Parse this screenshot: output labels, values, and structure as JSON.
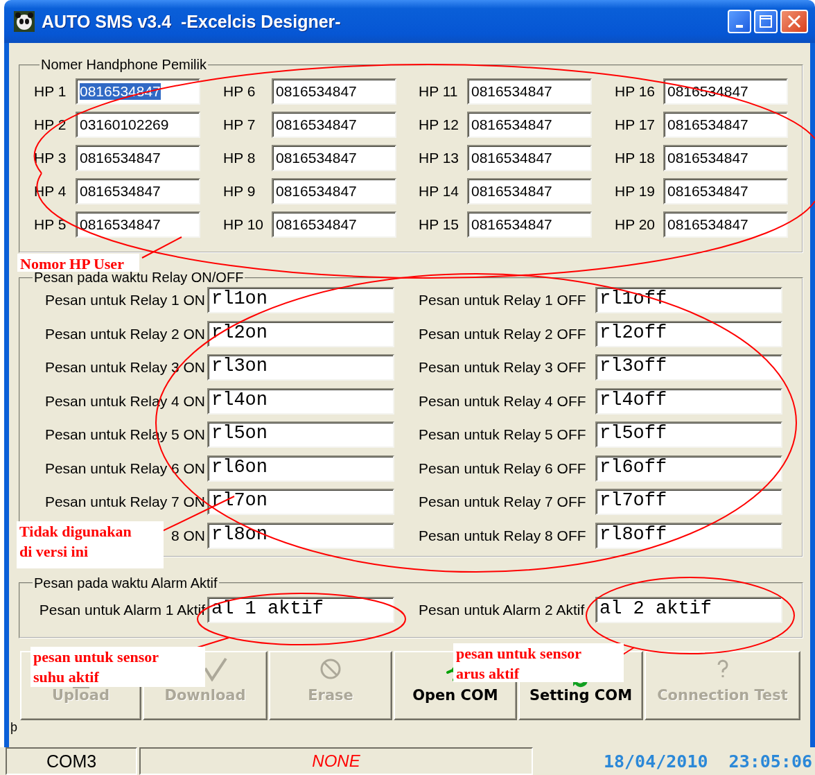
{
  "window": {
    "title": "AUTO SMS v3.4  -Excelcis Designer-"
  },
  "owner_numbers": {
    "legend": "Nomer Handphone Pemilik",
    "fields": [
      {
        "label": "HP 1",
        "value": "0816534847",
        "selected": true
      },
      {
        "label": "HP 2",
        "value": "03160102269",
        "selected": false
      },
      {
        "label": "HP 3",
        "value": "0816534847",
        "selected": false
      },
      {
        "label": "HP 4",
        "value": "0816534847",
        "selected": false
      },
      {
        "label": "HP 5",
        "value": "0816534847",
        "selected": false
      },
      {
        "label": "HP 6",
        "value": "0816534847",
        "selected": false
      },
      {
        "label": "HP 7",
        "value": "0816534847",
        "selected": false
      },
      {
        "label": "HP 8",
        "value": "0816534847",
        "selected": false
      },
      {
        "label": "HP 9",
        "value": "0816534847",
        "selected": false
      },
      {
        "label": "HP 10",
        "value": "0816534847",
        "selected": false
      },
      {
        "label": "HP 11",
        "value": "0816534847",
        "selected": false
      },
      {
        "label": "HP 12",
        "value": "0816534847",
        "selected": false
      },
      {
        "label": "HP 13",
        "value": "0816534847",
        "selected": false
      },
      {
        "label": "HP 14",
        "value": "0816534847",
        "selected": false
      },
      {
        "label": "HP 15",
        "value": "0816534847",
        "selected": false
      },
      {
        "label": "HP 16",
        "value": "0816534847",
        "selected": false
      },
      {
        "label": "HP 17",
        "value": "0816534847",
        "selected": false
      },
      {
        "label": "HP 18",
        "value": "0816534847",
        "selected": false
      },
      {
        "label": "HP 19",
        "value": "0816534847",
        "selected": false
      },
      {
        "label": "HP 20",
        "value": "0816534847",
        "selected": false
      }
    ]
  },
  "relay_messages": {
    "legend": "Pesan pada waktu Relay ON/OFF",
    "rows": [
      {
        "on_label": "Pesan untuk Relay 1 ON",
        "on_value": "rl1on",
        "off_label": "Pesan untuk Relay 1 OFF",
        "off_value": "rl1off"
      },
      {
        "on_label": "Pesan untuk Relay 2 ON",
        "on_value": "rl2on",
        "off_label": "Pesan untuk Relay 2 OFF",
        "off_value": "rl2off"
      },
      {
        "on_label": "Pesan untuk Relay 3 ON",
        "on_value": "rl3on",
        "off_label": "Pesan untuk Relay 3 OFF",
        "off_value": "rl3off"
      },
      {
        "on_label": "Pesan untuk Relay 4 ON",
        "on_value": "rl4on",
        "off_label": "Pesan untuk Relay 4 OFF",
        "off_value": "rl4off"
      },
      {
        "on_label": "Pesan untuk Relay 5 ON",
        "on_value": "rl5on",
        "off_label": "Pesan untuk Relay 5 OFF",
        "off_value": "rl5off"
      },
      {
        "on_label": "Pesan untuk Relay 6 ON",
        "on_value": "rl6on",
        "off_label": "Pesan untuk Relay 6 OFF",
        "off_value": "rl6off"
      },
      {
        "on_label": "Pesan untuk Relay 7 ON",
        "on_value": "rl7on",
        "off_label": "Pesan untuk Relay 7 OFF",
        "off_value": "rl7off"
      },
      {
        "on_label": "8 ON",
        "on_value": "rl8on",
        "off_label": "Pesan untuk Relay 8 OFF",
        "off_value": "rl8off"
      }
    ]
  },
  "alarm_messages": {
    "legend": "Pesan pada waktu Alarm Aktif",
    "rows": [
      {
        "label": "Pesan untuk Alarm 1 Aktif",
        "value": "al 1 aktif"
      },
      {
        "label": "Pesan untuk Alarm 2 Aktif",
        "value": "al 2 aktif"
      }
    ]
  },
  "buttons": [
    {
      "kind": "upload",
      "label": "Upload",
      "disabled": true
    },
    {
      "kind": "download",
      "label": "Download",
      "disabled": true
    },
    {
      "kind": "erase",
      "label": "Erase",
      "disabled": true
    },
    {
      "kind": "open",
      "label": "Open COM",
      "disabled": false
    },
    {
      "kind": "setting",
      "label": "Setting COM",
      "disabled": false
    },
    {
      "kind": "test",
      "label": "Connection Test",
      "disabled": true
    }
  ],
  "corner_glyph": "þ",
  "status_bar": {
    "port": "COM3",
    "state": "NONE",
    "datetime": "18/04/2010  23:05:06"
  },
  "annotations": [
    {
      "text": "Nomor HP User"
    },
    {
      "text": "Tidak digunakan\ndi versi ini"
    },
    {
      "text": "pesan untuk sensor\nsuhu aktif"
    },
    {
      "text": "pesan untuk sensor\narus aktif"
    }
  ]
}
